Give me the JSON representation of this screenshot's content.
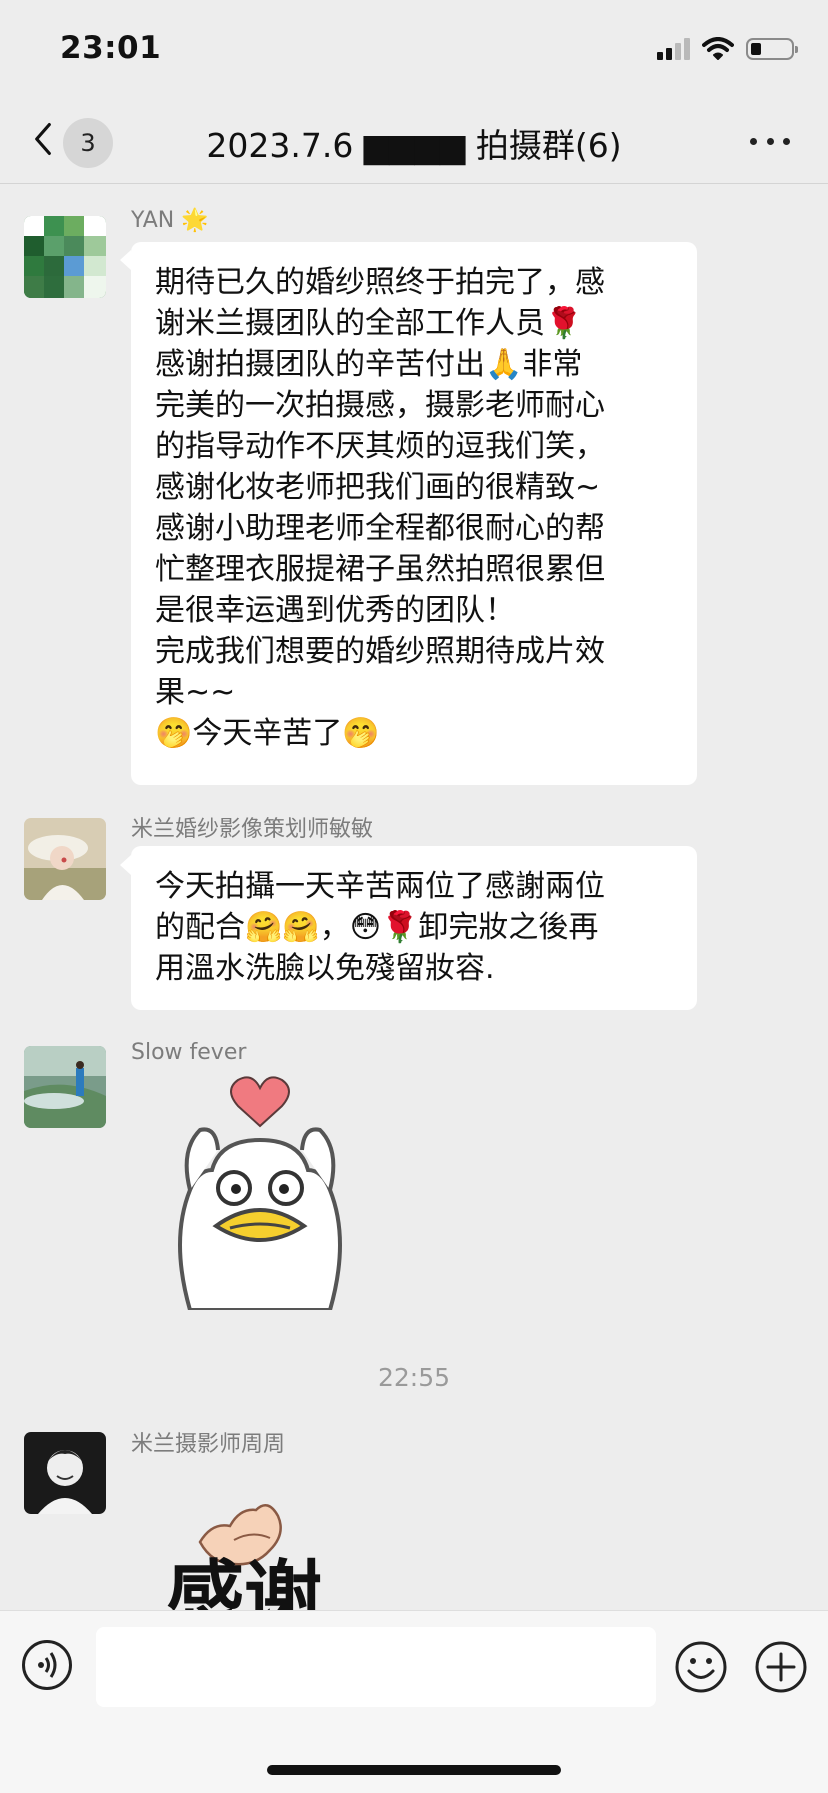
{
  "status_bar": {
    "time": "23:01"
  },
  "nav": {
    "unread_count": "3",
    "title": "2023.7.6 ▆▆▆▆ 拍摄群(6)"
  },
  "messages": [
    {
      "sender": "YAN 🌟",
      "lines": [
        "期待已久的婚纱照终于拍完了，感",
        "谢米兰摄团队的全部工作人员🌹",
        "感谢拍摄团队的辛苦付出🙏非常",
        "完美的一次拍摄感，摄影老师耐心",
        "的指导动作不厌其烦的逗我们笑，",
        "感谢化妆老师把我们画的很精致~",
        "感谢小助理老师全程都很耐心的帮",
        "忙整理衣服提裙子虽然拍照很累但",
        "是很幸运遇到优秀的团队！",
        "完成我们想要的婚纱照期待成片效",
        "果~~",
        "🤭今天辛苦了🤭"
      ]
    },
    {
      "sender": "米兰婚纱影像策划师敏敏",
      "lines": [
        "今天拍攝一天辛苦兩位了感謝兩位",
        "的配合🤗🤗，😳🌹卸完妝之後再",
        "用溫水洗臉以免殘留妝容."
      ]
    },
    {
      "sender": "Slow fever",
      "sticker": "duck-heart-sticker"
    },
    {
      "sender": "米兰摄影师周周",
      "sticker_text": "感谢"
    }
  ],
  "timestamp": "22:55",
  "input": {
    "placeholder": ""
  },
  "colors": {
    "background": "#ededed",
    "bubble": "#ffffff",
    "heart": "#f07a80",
    "beak": "#f5cf2e"
  }
}
